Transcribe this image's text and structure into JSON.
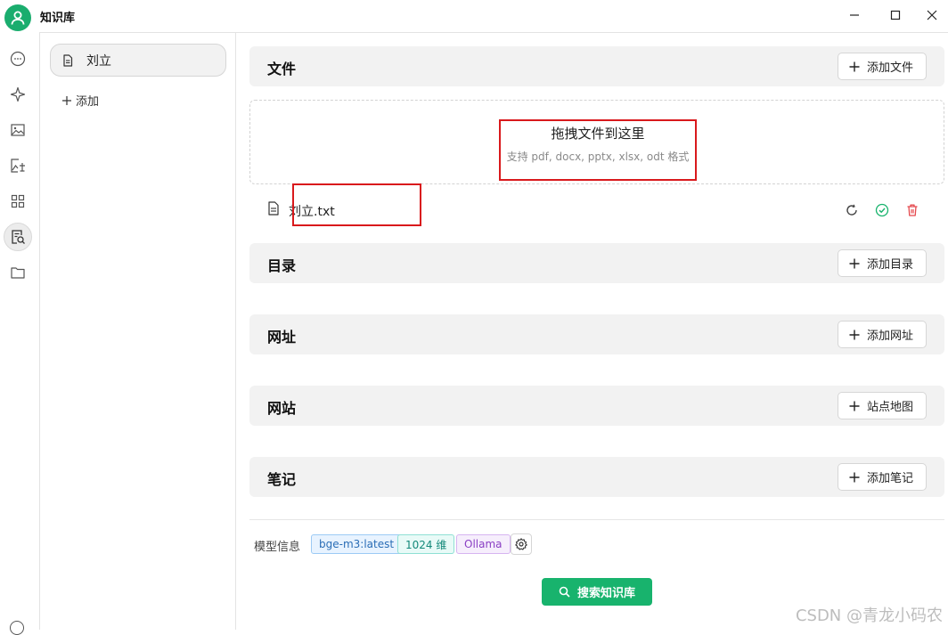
{
  "app": {
    "title": "知识库"
  },
  "sidebar": {
    "knowledge_base": "刘立",
    "add_label": "添加"
  },
  "sections": {
    "files": {
      "title": "文件",
      "button": "添加文件"
    },
    "directories": {
      "title": "目录",
      "button": "添加目录"
    },
    "urls": {
      "title": "网址",
      "button": "添加网址"
    },
    "websites": {
      "title": "网站",
      "button": "站点地图"
    },
    "notes": {
      "title": "笔记",
      "button": "添加笔记"
    }
  },
  "dropzone": {
    "title": "拖拽文件到这里",
    "subtitle": "支持 pdf, docx, pptx, xlsx, odt 格式"
  },
  "files": [
    {
      "name": "刘立.txt"
    }
  ],
  "model": {
    "label": "模型信息",
    "tags": [
      "bge-m3:latest",
      "1024 维",
      "Ollama"
    ]
  },
  "search_button": "搜索知识库",
  "watermark": "CSDN @青龙小码农",
  "colors": {
    "accent": "#18b36d",
    "highlight_box": "#d9191c"
  },
  "icons": [
    "chat-icon",
    "sparkle-icon",
    "image-icon",
    "image-edit-icon",
    "grid-icon",
    "knowledge-search-icon",
    "folder-icon"
  ]
}
